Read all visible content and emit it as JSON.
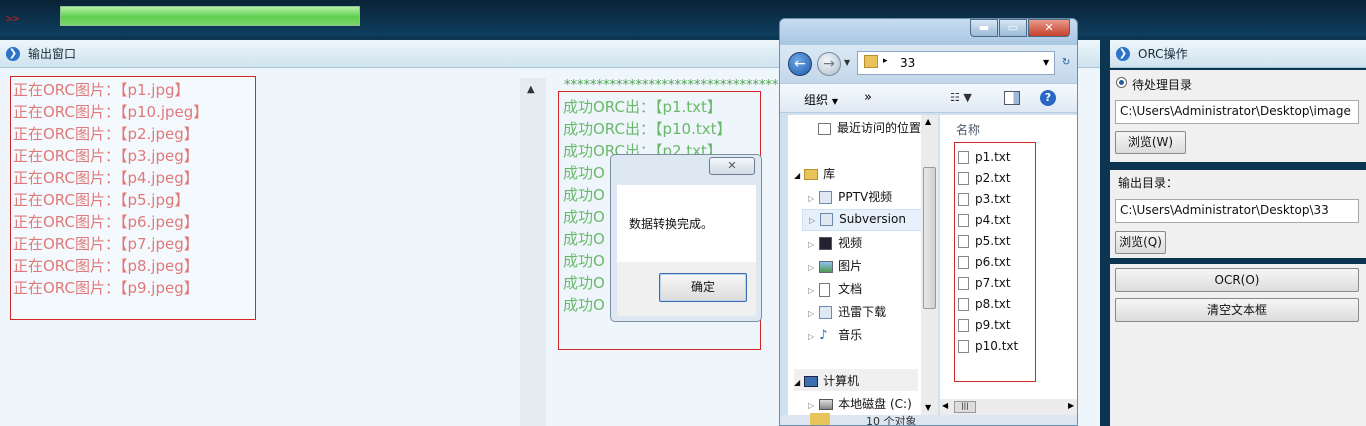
{
  "top": {
    "arrows": ">>",
    "progress": 1.0
  },
  "output_panel": {
    "title": "输出窗口"
  },
  "left_log": [
    "正在ORC图片：【p1.jpg】",
    "正在ORC图片：【p10.jpeg】",
    "正在ORC图片：【p2.jpeg】",
    "正在ORC图片：【p3.jpeg】",
    "正在ORC图片：【p4.jpeg】",
    "正在ORC图片：【p5.jpg】",
    "正在ORC图片：【p6.jpeg】",
    "正在ORC图片：【p7.jpeg】",
    "正在ORC图片：【p8.jpeg】",
    "正在ORC图片：【p9.jpeg】"
  ],
  "right_log": {
    "stars": "**********************************",
    "lines": [
      "成功ORC出：【p1.txt】",
      "成功ORC出：【p10.txt】",
      "成功ORC出：【p2.txt】",
      "成功O",
      "成功O",
      "成功O",
      "成功O",
      "成功O",
      "成功O",
      "成功O"
    ]
  },
  "dialog": {
    "message": "数据转换完成。",
    "ok": "确定",
    "close": "✕"
  },
  "side": {
    "title": "ORC操作",
    "pending_label": "待处理目录",
    "pending_path": "C:\\Users\\Administrator\\Desktop\\image",
    "browse_w": "浏览(W)",
    "output_label": "输出目录：",
    "output_path": "C:\\Users\\Administrator\\Desktop\\33",
    "browse_q": "浏览(Q)",
    "ocr": "OCR(O)",
    "clear": "清空文本框"
  },
  "explorer": {
    "path": "33",
    "organize": "组织",
    "more": "»",
    "column_name": "名称",
    "nav": [
      {
        "label": "最近访问的位置"
      },
      {
        "label": "库"
      },
      {
        "label": "PPTV视频"
      },
      {
        "label": "Subversion"
      },
      {
        "label": "视频"
      },
      {
        "label": "图片"
      },
      {
        "label": "文档"
      },
      {
        "label": "迅雷下载"
      },
      {
        "label": "音乐"
      },
      {
        "label": "计算机"
      },
      {
        "label": "本地磁盘 (C:)"
      }
    ],
    "files": [
      "p1.txt",
      "p2.txt",
      "p3.txt",
      "p4.txt",
      "p5.txt",
      "p6.txt",
      "p7.txt",
      "p8.txt",
      "p9.txt",
      "p10.txt"
    ],
    "status": "10 个对象"
  }
}
